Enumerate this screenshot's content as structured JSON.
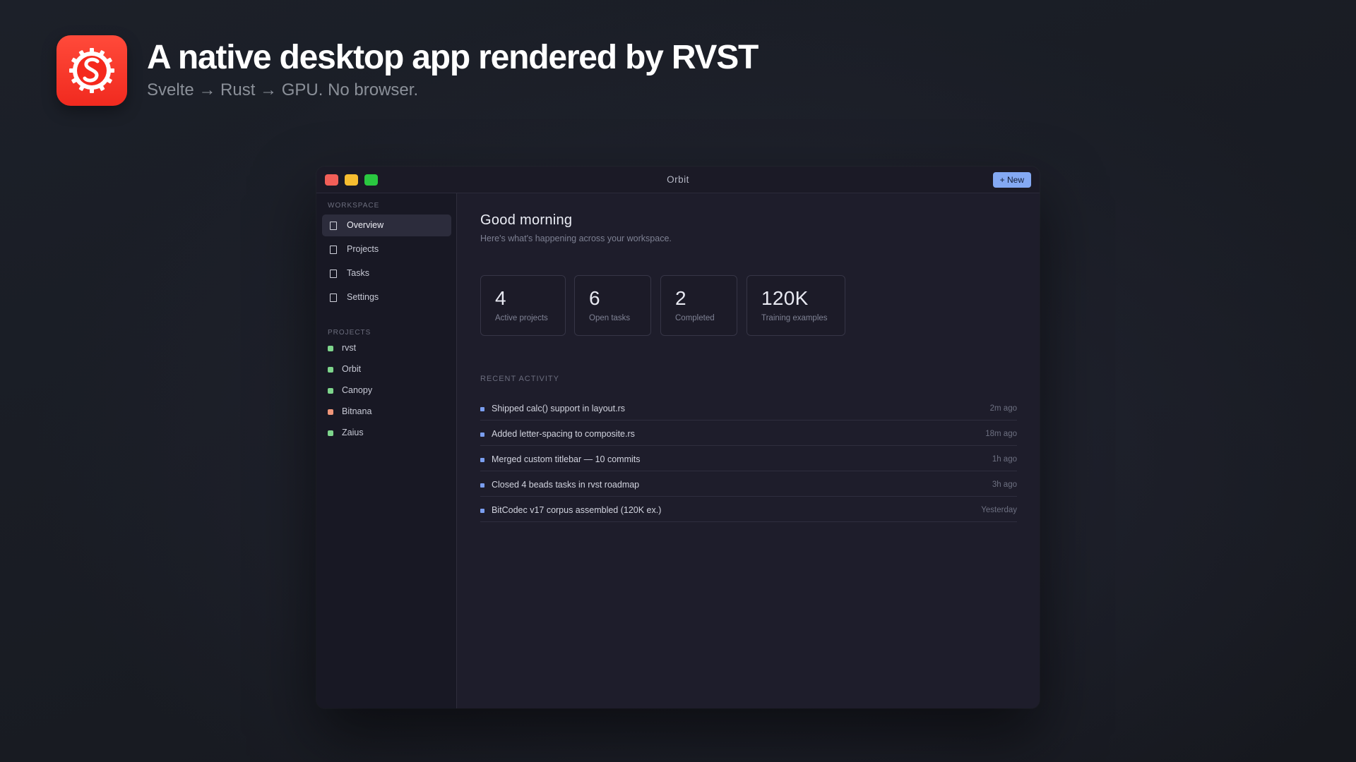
{
  "hero": {
    "title": "A native desktop app rendered by RVST",
    "subtitle": "Svelte → Rust → GPU. No browser.",
    "logo_icon": "svelte-gear-logo-icon",
    "logo_color": "#f5291d"
  },
  "window": {
    "title": "Orbit",
    "new_button": "+ New",
    "accent": "#84a9f3"
  },
  "sidebar": {
    "workspace_label": "WORKSPACE",
    "nav": [
      {
        "label": "Overview",
        "icon": "square-outline-icon",
        "active": true
      },
      {
        "label": "Projects",
        "icon": "square-outline-icon",
        "active": false
      },
      {
        "label": "Tasks",
        "icon": "square-outline-icon",
        "active": false
      },
      {
        "label": "Settings",
        "icon": "square-outline-icon",
        "active": false
      }
    ],
    "projects_label": "PROJECTS",
    "projects": [
      {
        "label": "rvst",
        "color": "#7ed58c"
      },
      {
        "label": "Orbit",
        "color": "#7ed58c"
      },
      {
        "label": "Canopy",
        "color": "#7ed58c"
      },
      {
        "label": "Bitnana",
        "color": "#f0967a"
      },
      {
        "label": "Zaius",
        "color": "#7ed58c"
      }
    ]
  },
  "main": {
    "greeting": "Good morning",
    "subtitle": "Here's what's happening across your workspace.",
    "stats": [
      {
        "value": "4",
        "label": "Active projects"
      },
      {
        "value": "6",
        "label": "Open tasks"
      },
      {
        "value": "2",
        "label": "Completed"
      },
      {
        "value": "120K",
        "label": "Training examples"
      }
    ],
    "activity_label": "RECENT ACTIVITY",
    "activity": [
      {
        "text": "Shipped calc() support in layout.rs",
        "time": "2m ago"
      },
      {
        "text": "Added letter-spacing to composite.rs",
        "time": "18m ago"
      },
      {
        "text": "Merged custom titlebar — 10 commits",
        "time": "1h ago"
      },
      {
        "text": "Closed 4 beads tasks in rvst roadmap",
        "time": "3h ago"
      },
      {
        "text": "BitCodec v17 corpus assembled (120K ex.)",
        "time": "Yesterday"
      }
    ]
  }
}
